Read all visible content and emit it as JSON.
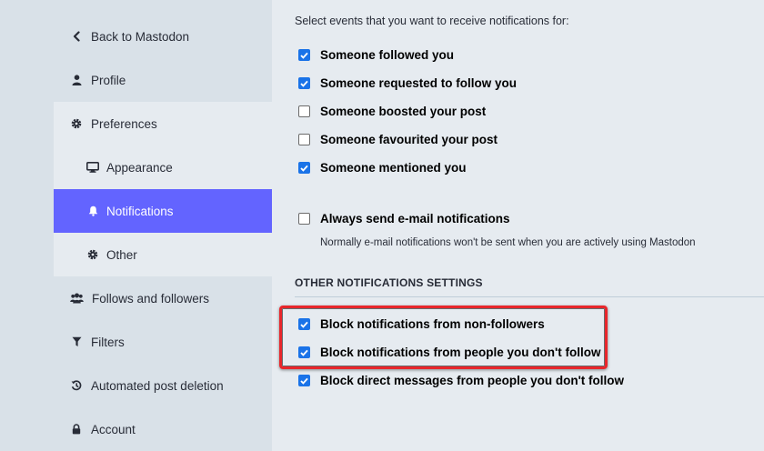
{
  "sidebar": {
    "items": [
      {
        "label": "Back to Mastodon",
        "icon": "chevron-left-icon"
      },
      {
        "label": "Profile",
        "icon": "user-icon"
      },
      {
        "label": "Preferences",
        "icon": "gear-icon"
      },
      {
        "label": "Appearance",
        "icon": "desktop-icon"
      },
      {
        "label": "Notifications",
        "icon": "bell-icon",
        "active": true
      },
      {
        "label": "Other",
        "icon": "gear-icon"
      },
      {
        "label": "Follows and followers",
        "icon": "users-icon"
      },
      {
        "label": "Filters",
        "icon": "filter-icon"
      },
      {
        "label": "Automated post deletion",
        "icon": "history-icon"
      },
      {
        "label": "Account",
        "icon": "lock-icon"
      }
    ]
  },
  "main": {
    "intro": "Select events that you want to receive notifications for:",
    "events": [
      {
        "label": "Someone followed you",
        "checked": true
      },
      {
        "label": "Someone requested to follow you",
        "checked": true
      },
      {
        "label": "Someone boosted your post",
        "checked": false
      },
      {
        "label": "Someone favourited your post",
        "checked": false
      },
      {
        "label": "Someone mentioned you",
        "checked": true
      }
    ],
    "email": {
      "label": "Always send e-mail notifications",
      "checked": false,
      "hint": "Normally e-mail notifications won't be sent when you are actively using Mastodon"
    },
    "other_section_title": "OTHER NOTIFICATIONS SETTINGS",
    "other": [
      {
        "label": "Block notifications from non-followers",
        "checked": true
      },
      {
        "label": "Block notifications from people you don't follow",
        "checked": true
      },
      {
        "label": "Block direct messages from people you don't follow",
        "checked": true
      }
    ]
  },
  "colors": {
    "accent": "#6364ff",
    "checkbox": "#1a73e8",
    "highlight": "#e8262b"
  }
}
